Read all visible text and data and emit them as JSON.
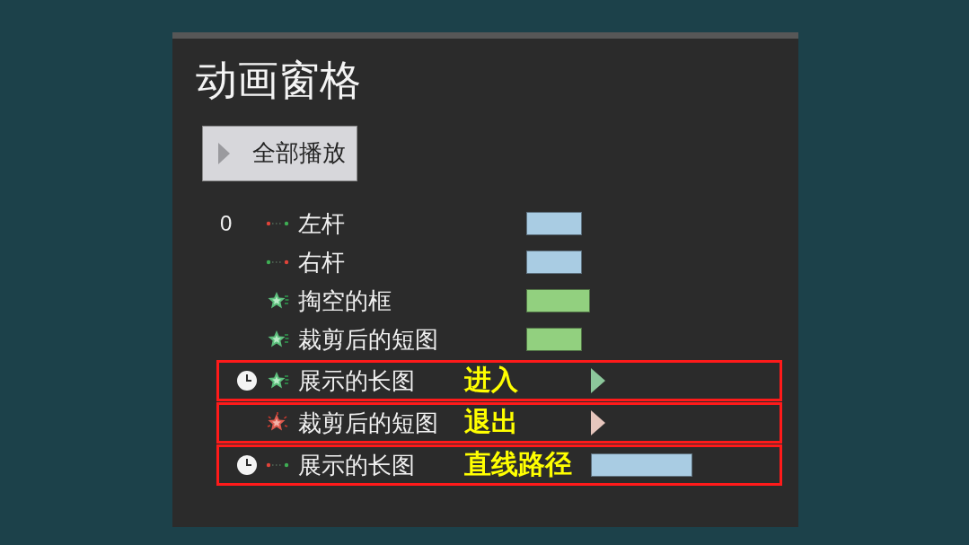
{
  "pane": {
    "title": "动画窗格",
    "play_all": "全部播放",
    "items": [
      {
        "step": "0",
        "after_previous": false,
        "kind": "motion",
        "name": "左杆",
        "highlighted": false,
        "timing": {
          "kind": "bar",
          "color": "#a9cce3",
          "level": 0.22,
          "delayed": false
        }
      },
      {
        "after_previous": false,
        "kind": "reverse",
        "name": "右杆",
        "highlighted": false,
        "timing": {
          "kind": "bar",
          "color": "#a9cce3",
          "level": 0.22,
          "delayed": false
        }
      },
      {
        "after_previous": false,
        "kind": "entrance",
        "name": "掏空的框",
        "highlighted": false,
        "timing": {
          "kind": "bar",
          "color": "#92d07f",
          "level": 0.25,
          "delayed": false
        }
      },
      {
        "after_previous": false,
        "kind": "entrance",
        "name": "裁剪后的短图",
        "highlighted": false,
        "timing": {
          "kind": "bar",
          "color": "#92d07f",
          "level": 0.22,
          "delayed": false
        }
      },
      {
        "after_previous": true,
        "kind": "entrance",
        "name": "展示的长图",
        "highlighted": true,
        "annotation": "进入",
        "timing": {
          "kind": "marker",
          "color": "#8cc79b",
          "delayed": true
        }
      },
      {
        "after_previous": false,
        "kind": "exit",
        "name": "裁剪后的短图",
        "highlighted": true,
        "annotation": "退出",
        "timing": {
          "kind": "marker",
          "color": "#e6c6bd",
          "delayed": true
        }
      },
      {
        "after_previous": true,
        "kind": "motion",
        "name": "展示的长图",
        "highlighted": true,
        "annotation": "直线路径",
        "timing": {
          "kind": "bar",
          "color": "#a9cce3",
          "level": 0.4,
          "delayed": true
        }
      }
    ]
  }
}
